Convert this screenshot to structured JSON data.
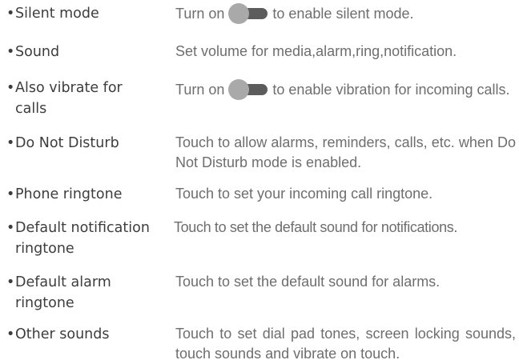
{
  "colors": {
    "term_text": "#3d3d3d",
    "desc_text": "#6e6e6e",
    "toggle_knob": "#a9a9a9",
    "toggle_track": "#5c5c5c"
  },
  "items": [
    {
      "term": "Silent mode",
      "desc_before": "Turn on",
      "desc_after": "to enable silent mode."
    },
    {
      "term": "Sound",
      "desc": "Set volume for media,alarm,ring,notification."
    },
    {
      "term_line1": "Also vibrate for",
      "term_line2": "calls",
      "desc_before": "Turn on",
      "desc_after": "to enable vibration for incoming calls."
    },
    {
      "term": "Do Not Disturb",
      "desc": "Touch to allow alarms, reminders, calls, etc. when Do Not Disturb mode is enabled."
    },
    {
      "term": "Phone ringtone",
      "desc": "Touch to set your incoming call ringtone."
    },
    {
      "term_line1": "Default notification",
      "term_line2": "ringtone",
      "desc": "Touch to set the default sound for notifications."
    },
    {
      "term_line1": "Default alarm",
      "term_line2": "ringtone",
      "desc": "Touch to set the default sound for alarms."
    },
    {
      "term": "Other sounds",
      "desc": "Touch to set dial pad tones, screen locking sounds, touch sounds and vibrate on touch."
    }
  ]
}
